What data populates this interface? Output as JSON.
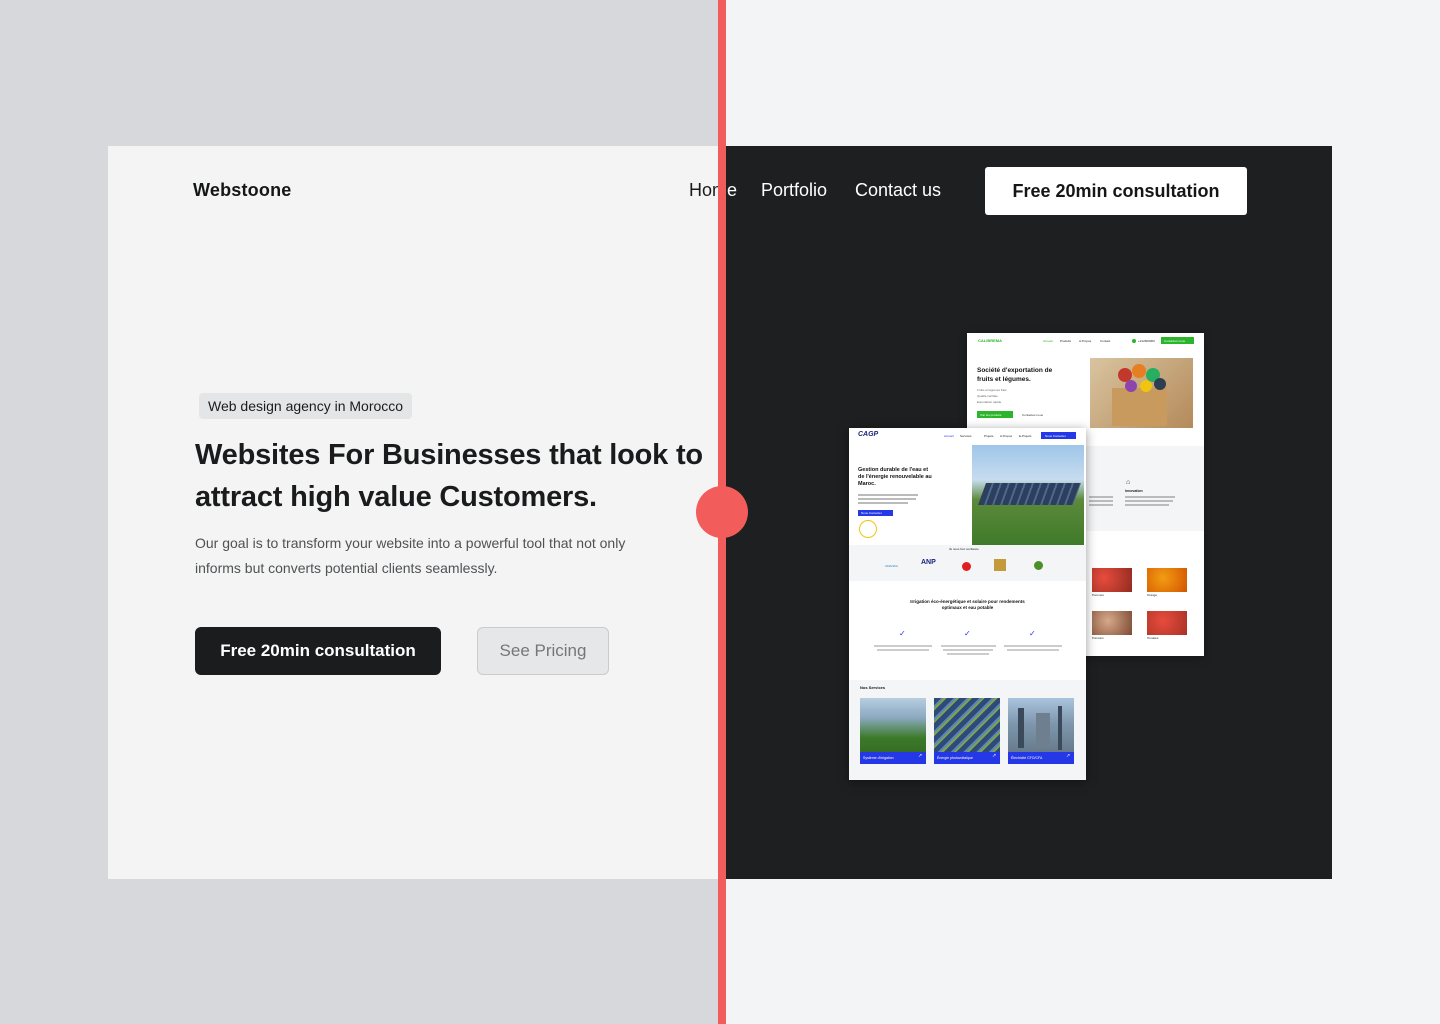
{
  "brand": {
    "name": "Webstoone"
  },
  "nav": {
    "items": [
      "Home",
      "Portfolio",
      "Contact us"
    ],
    "cta": "Free 20min consultation"
  },
  "hero": {
    "badge": "Web design agency in Morocco",
    "headline_line1": "Websites For Businesses that look to",
    "headline_line2": "attract high value Customers.",
    "subtext_line1": "Our goal is to transform your website into a powerful tool that not only",
    "subtext_line2": "informs but converts potential clients seamlessly.",
    "primary_cta": "Free 20min consultation",
    "secondary_cta": "See Pricing"
  },
  "mock_back": {
    "logo": "CALIBREMA",
    "nav": [
      "Accueil",
      "Produits",
      "A Propos",
      "Contact"
    ],
    "phone": "+212600000",
    "cta": "Contactez-nous",
    "title_line1": "Société d'exportation de",
    "title_line2": "fruits et légumes.",
    "bullets": [
      "Fruits et légumes frais",
      "Qualité certifiée",
      "Exportation rapide"
    ],
    "btn1": "Voir les produits",
    "btn2": "Contactez-nous",
    "feature_title": "Innovation",
    "products": [
      "Pommes",
      "Orange",
      "Poivrons",
      "Tomates"
    ]
  },
  "mock_front": {
    "logo": "CAGP",
    "nav": [
      "Accueil",
      "Services",
      "Projets",
      "A Propos",
      "E-Projets"
    ],
    "cta": "Nous Contacter",
    "title_line1": "Gestion durable de l'eau et",
    "title_line2": "de l'énergie renouvelable au",
    "title_line3": "Maroc.",
    "btn": "Nous Contacter",
    "trust_label": "Ils nous font confiance",
    "partners": [
      "AMANDA",
      "ANP",
      "HUAWEI",
      "ROYAUME",
      "ORMVA"
    ],
    "section_title_line1": "Irrigation éco-énergétique et solaire pour rendements",
    "section_title_line2": "optimaux et eau potable",
    "services_title": "Nos Services",
    "services": [
      "Système d'irrigation",
      "Énergie photovoltaïque",
      "Électricité CFO/CFA"
    ]
  },
  "colors": {
    "accent_red": "#f25c5a",
    "dark": "#1d1f21",
    "green": "#2bb52b",
    "blue": "#2438e8"
  }
}
